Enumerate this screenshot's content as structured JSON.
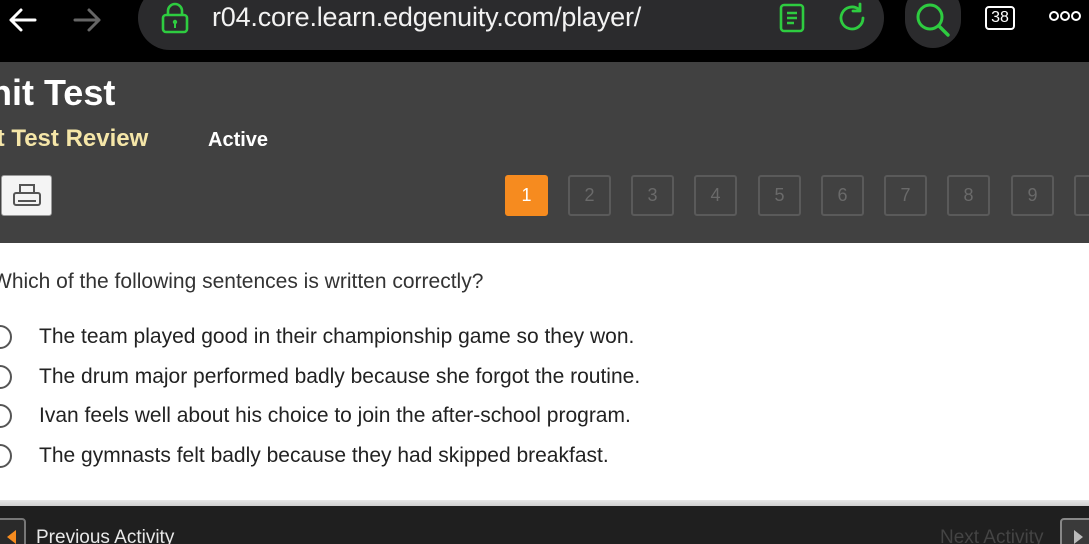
{
  "browser": {
    "url": "r04.core.learn.edgenuity.com/player/",
    "tab_count": "38",
    "icons": {
      "back": "back-arrow-icon",
      "forward": "forward-arrow-icon",
      "lock": "lock-icon",
      "reader": "reader-mode-icon",
      "reload": "reload-icon",
      "search": "search-icon",
      "more": "more-icon"
    },
    "accent_color": "#2ecc40"
  },
  "header": {
    "course_title": "nit Test",
    "activity_title": "it Test Review",
    "status": "Active",
    "question_numbers": [
      "1",
      "2",
      "3",
      "4",
      "5",
      "6",
      "7",
      "8",
      "9"
    ],
    "current_question": "1",
    "active_color": "#f68b1f"
  },
  "question": {
    "prompt": "Which of the following sentences is written correctly?",
    "options": [
      "The team played good in their championship game so they won.",
      "The drum major performed badly because she forgot the routine.",
      "Ivan feels well about his choice to join the after-school program.",
      "The gymnasts felt badly because they had skipped breakfast."
    ]
  },
  "footer": {
    "previous_label": "Previous Activity",
    "next_label": "Next Activity"
  }
}
